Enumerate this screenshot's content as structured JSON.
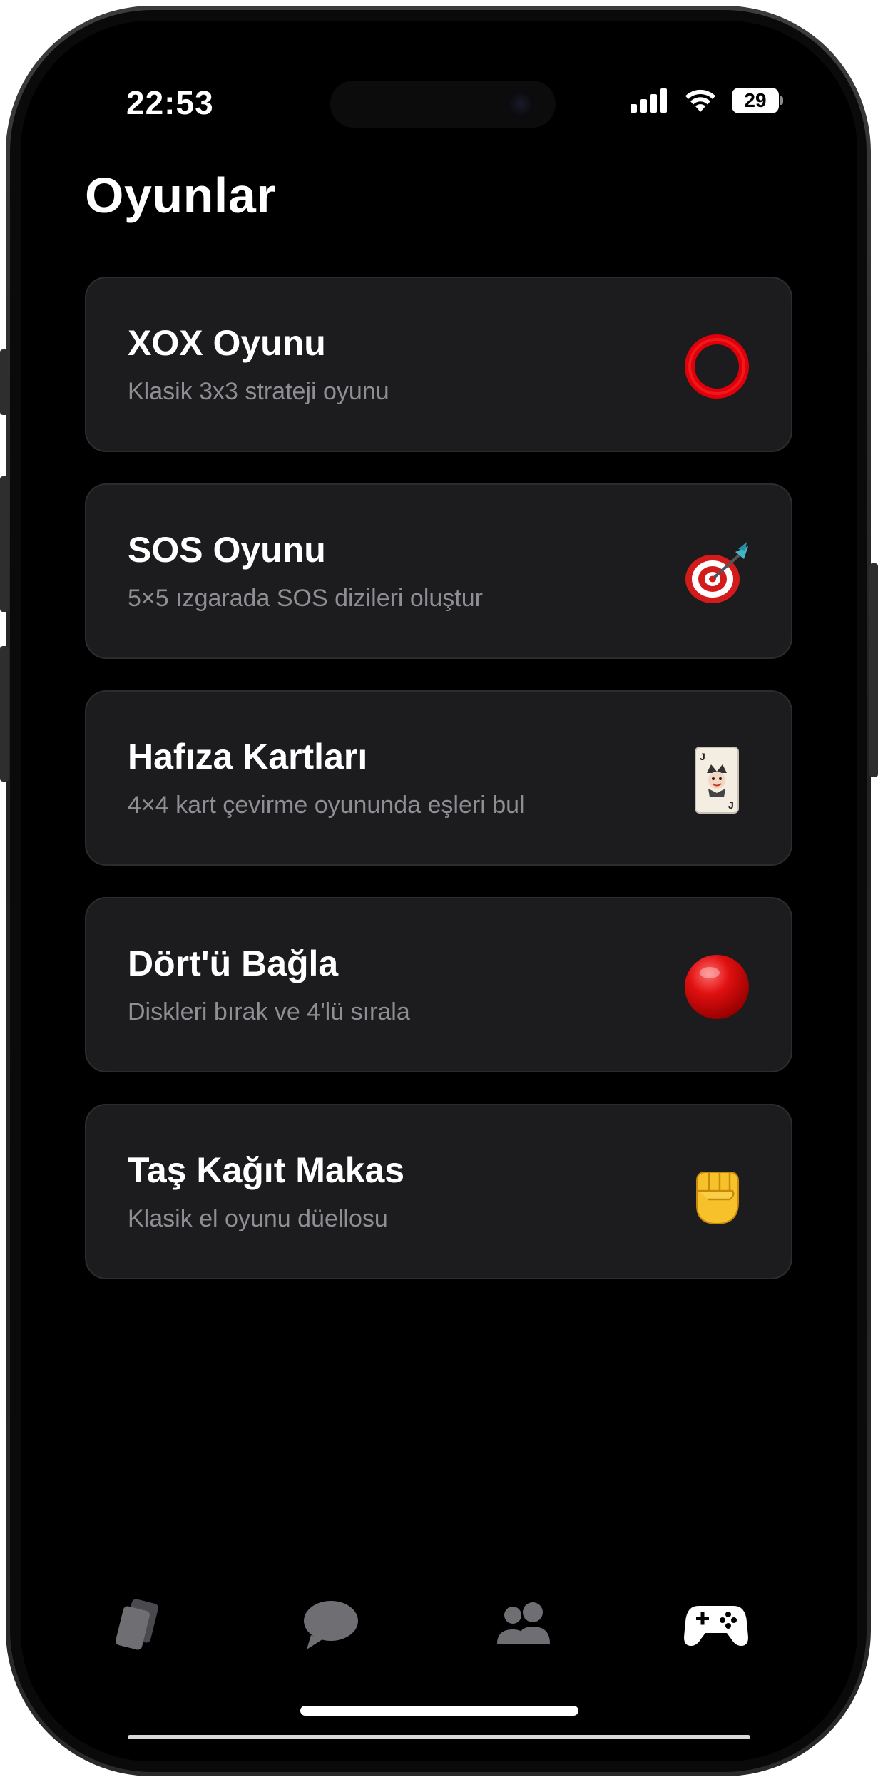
{
  "status_bar": {
    "time": "22:53",
    "battery": "29"
  },
  "page": {
    "title": "Oyunlar"
  },
  "games": [
    {
      "title": "XOX Oyunu",
      "subtitle": "Klasik 3x3 strateji oyunu",
      "icon": "red-ring-icon"
    },
    {
      "title": "SOS Oyunu",
      "subtitle": "5×5 ızgarada SOS dizileri oluştur",
      "icon": "dart-target-icon"
    },
    {
      "title": "Hafıza Kartları",
      "subtitle": "4×4 kart çevirme oyununda eşleri bul",
      "icon": "joker-card-icon"
    },
    {
      "title": "Dört'ü Bağla",
      "subtitle": "Diskleri bırak ve 4'lü sırala",
      "icon": "red-disc-icon"
    },
    {
      "title": "Taş Kağıt Makas",
      "subtitle": "Klasik el oyunu düellosu",
      "icon": "raised-fist-icon"
    }
  ],
  "tab_bar": {
    "tabs": [
      {
        "icon": "cards-icon",
        "active": false
      },
      {
        "icon": "chat-bubble-icon",
        "active": false
      },
      {
        "icon": "people-icon",
        "active": false
      },
      {
        "icon": "gamepad-icon",
        "active": true
      }
    ]
  },
  "colors": {
    "background": "#000000",
    "card": "#1c1c1e",
    "card_border": "#2c2c2e",
    "subtitle": "#8e8e93",
    "inactive_tab": "#6e6e73",
    "active_tab": "#ffffff"
  }
}
